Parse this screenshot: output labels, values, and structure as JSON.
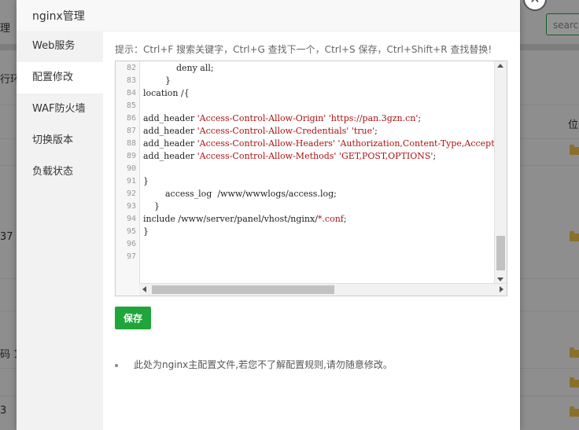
{
  "background": {
    "left_fragments": [
      "理",
      "行环",
      "37",
      "码 1",
      "3"
    ],
    "search_placeholder": "searc",
    "column_header_right": "位"
  },
  "modal": {
    "title": "nginx管理",
    "close_glyph": "✕",
    "sidebar": [
      {
        "label": "Web服务",
        "active": false
      },
      {
        "label": "配置修改",
        "active": true
      },
      {
        "label": "WAF防火墙",
        "active": false
      },
      {
        "label": "切换版本",
        "active": false
      },
      {
        "label": "负载状态",
        "active": false
      }
    ],
    "hint": "提示：Ctrl+F 搜索关键字，Ctrl+G 查找下一个，Ctrl+S 保存，Ctrl+Shift+R 查找替换!",
    "editor": {
      "lines": [
        {
          "n": "82",
          "code": "            deny all;"
        },
        {
          "n": "83",
          "code": "        }"
        },
        {
          "n": "84",
          "code": "location /{"
        },
        {
          "n": "85",
          "code": ""
        },
        {
          "n": "86",
          "code": "add_header ",
          "s1": "'Access-Control-Allow-Origin'",
          "mid": " ",
          "s2": "'https://pan.3gzn.cn'",
          "tail": ";"
        },
        {
          "n": "87",
          "code": "add_header ",
          "s1": "'Access-Control-Allow-Credentials'",
          "mid": " ",
          "s2": "'true'",
          "tail": ";"
        },
        {
          "n": "88",
          "code": "add_header ",
          "s1": "'Access-Control-Allow-Headers'",
          "mid": " ",
          "s2": "'Authorization,Content-Type,Accept,Or",
          "tail": ""
        },
        {
          "n": "89",
          "code": "add_header ",
          "s1": "'Access-Control-Allow-Methods'",
          "mid": " ",
          "s2": "'GET,POST,OPTIONS'",
          "tail": ";"
        },
        {
          "n": "90",
          "code": ""
        },
        {
          "n": "91",
          "code": "}"
        },
        {
          "n": "92",
          "code": "        access_log  /www/wwwlogs/access.log;"
        },
        {
          "n": "93",
          "code": "    }"
        },
        {
          "n": "94",
          "code": "include /www/server/panel/vhost/nginx/",
          "s1": "*.conf",
          "mid": "",
          "s2": "",
          "tail": ";"
        },
        {
          "n": "95",
          "code": "}"
        },
        {
          "n": "96",
          "code": ""
        },
        {
          "n": "97",
          "code": ""
        }
      ]
    },
    "save_label": "保存",
    "note": "此处为nginx主配置文件,若您不了解配置规则,请勿随意修改。"
  },
  "colors": {
    "accent": "#20a53a",
    "string": "#aa1111"
  }
}
